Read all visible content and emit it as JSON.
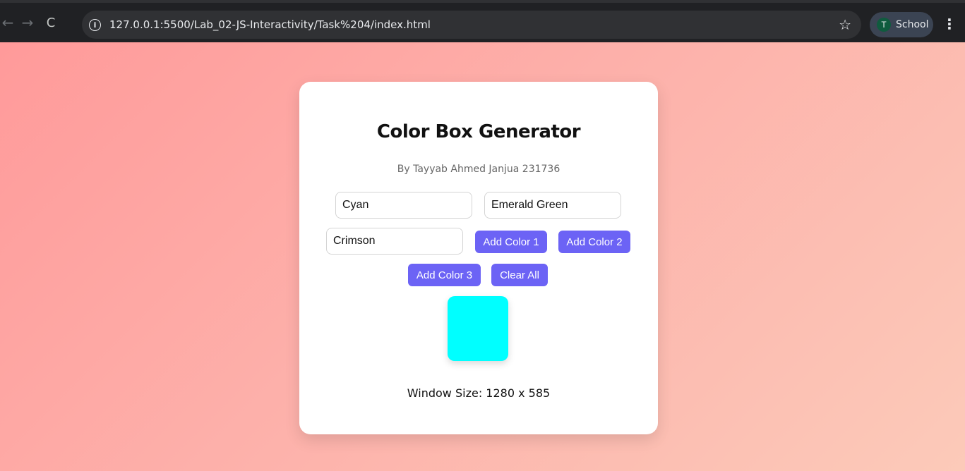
{
  "browser": {
    "back_icon": "←",
    "forward_icon": "→",
    "reload_icon": "C",
    "info_icon": "i",
    "url": "127.0.0.1:5500/Lab_02-JS-Interactivity/Task%204/index.html",
    "star_icon": "☆",
    "profile_initial": "T",
    "profile_name": "School",
    "menu_icon": "⋮"
  },
  "card": {
    "title": "Color Box Generator",
    "subtitle": "By Tayyab Ahmed Janjua 231736",
    "inputs": {
      "color1": "Cyan",
      "color2": "Emerald Green",
      "color3": "Crimson"
    },
    "buttons": {
      "add_color_1": "Add Color 1",
      "add_color_2": "Add Color 2",
      "add_color_3": "Add Color 3",
      "clear_all": "Clear All"
    },
    "box_color": "#00ffff",
    "window_size_text": "Window Size: 1280 x 585"
  },
  "colors": {
    "accent": "#6c63f5",
    "gradient_start": "#ff9a9a",
    "gradient_end": "#fccab9"
  }
}
